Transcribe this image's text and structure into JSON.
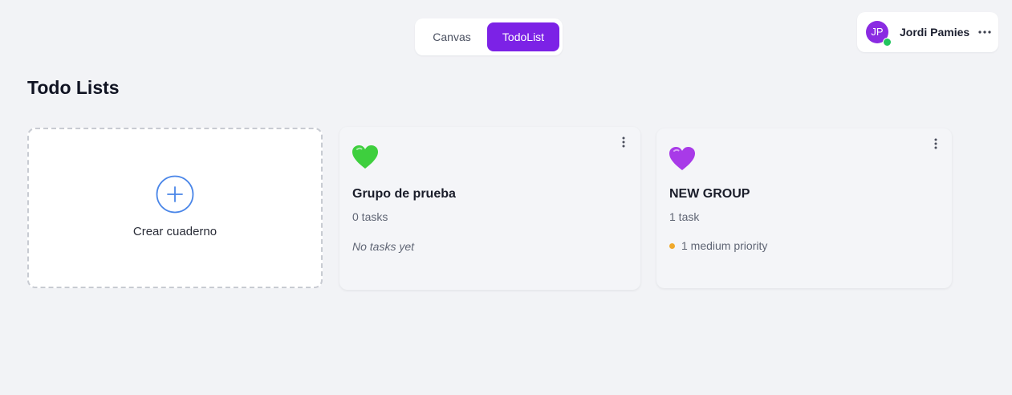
{
  "view_switcher": {
    "tabs": [
      {
        "label": "Canvas",
        "active": false
      },
      {
        "label": "TodoList",
        "active": true
      }
    ],
    "active_color": "#7c22e6"
  },
  "user": {
    "initials": "JP",
    "name": "Jordi Pamies",
    "avatar_color": "#8a2be2",
    "status_color": "#22c55e",
    "status": "online",
    "menu_icon": "more-horizontal-icon"
  },
  "page": {
    "title": "Todo Lists"
  },
  "create_card": {
    "label": "Crear cuaderno",
    "icon": "plus-circle-icon",
    "icon_color": "#4a86e8"
  },
  "groups": [
    {
      "emoji": "green-heart",
      "heart_color": "#3ecf3e",
      "title": "Grupo de prueba",
      "task_count": "0 tasks",
      "empty_text": "No tasks yet"
    },
    {
      "emoji": "purple-heart",
      "heart_color": "#a83ae8",
      "title": "NEW GROUP",
      "task_count": "1 task",
      "priority_text": "1 medium priority",
      "priority_color": "#f0a92b"
    }
  ]
}
